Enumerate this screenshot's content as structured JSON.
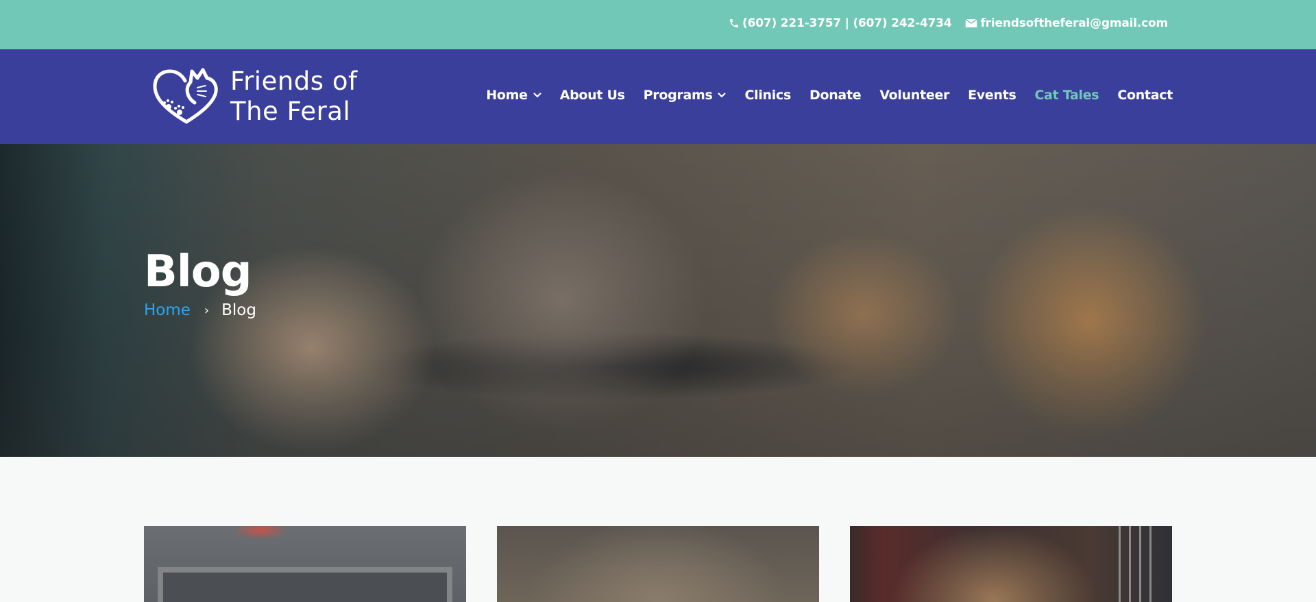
{
  "topbar": {
    "phone": "(607) 221-3757 | (607) 242-4734",
    "email": "friendsoftheferal@gmail.com"
  },
  "header": {
    "logo": {
      "line1": "Friends of",
      "line2": "The Feral"
    },
    "nav": [
      {
        "label": "Home",
        "has_dropdown": true
      },
      {
        "label": "About Us",
        "has_dropdown": false
      },
      {
        "label": "Programs",
        "has_dropdown": true
      },
      {
        "label": "Clinics",
        "has_dropdown": false
      },
      {
        "label": "Donate",
        "has_dropdown": false
      },
      {
        "label": "Volunteer",
        "has_dropdown": false
      },
      {
        "label": "Events",
        "has_dropdown": false
      },
      {
        "label": "Cat Tales",
        "has_dropdown": false,
        "active": true
      },
      {
        "label": "Contact",
        "has_dropdown": false
      }
    ]
  },
  "hero": {
    "title": "Blog",
    "breadcrumb": {
      "home": "Home",
      "separator": "›",
      "current": "Blog"
    }
  },
  "colors": {
    "topbar_bg": "#72c8b6",
    "header_bg": "#3a3f9c",
    "active_nav": "#72c8b6",
    "breadcrumb_link": "#2ea3f2",
    "page_bg": "#f7f8f8"
  },
  "icons": {
    "phone": "phone-icon",
    "email": "envelope-icon",
    "dropdown": "chevron-down-icon",
    "logo": "heart-cat-paw-icon"
  }
}
